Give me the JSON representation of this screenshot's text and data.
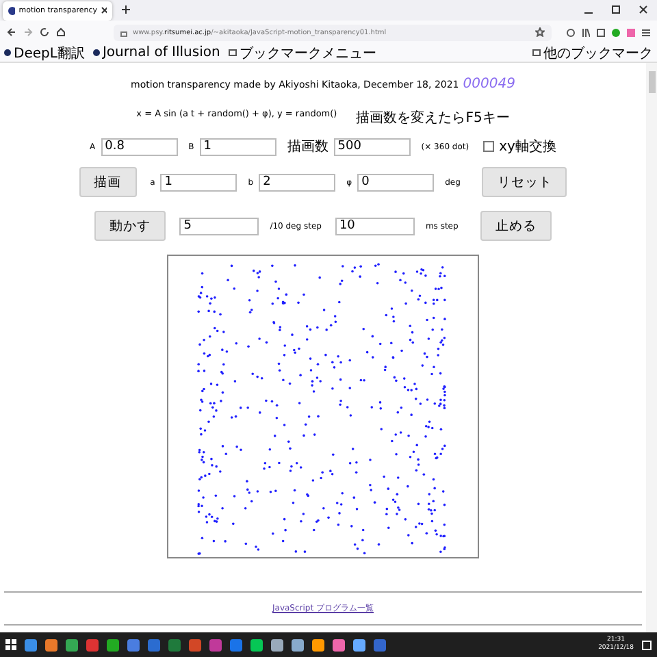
{
  "browser": {
    "tab_title": "motion transparency",
    "url": "www.psy.**ritsumei.ac.jp**/~akitaoka/JavaScript-motion_transparency01.html",
    "bookmarks": [
      {
        "kind": "site",
        "label": "DeepL翻訳"
      },
      {
        "kind": "site",
        "label": "Journal of Illusion"
      },
      {
        "kind": "folder",
        "label": "ブックマークメニュー"
      }
    ],
    "other_bookmarks": "他のブックマーク"
  },
  "page": {
    "credit": "motion transparency made by Akiyoshi Kitaoka, December 18, 2021",
    "counter": "000049",
    "formula": "x = A sin (a t + random() + φ), y = random()",
    "note": "描画数を変えたらF5キー",
    "row1": [
      {
        "kind": "field",
        "label": "A",
        "value": "0.8"
      },
      {
        "kind": "field",
        "label": "B",
        "value": "1"
      },
      {
        "kind": "field",
        "label": "描画数",
        "value": "500"
      },
      {
        "kind": "text",
        "label": "(× 360 dot)"
      },
      {
        "kind": "checkbox",
        "label": "xy軸交換",
        "checked": false
      }
    ],
    "row2": [
      {
        "kind": "button",
        "label": "描画"
      },
      {
        "kind": "field",
        "label": "a",
        "value": "1"
      },
      {
        "kind": "field",
        "label": "b",
        "value": "2"
      },
      {
        "kind": "field",
        "label": "φ",
        "value": "0"
      },
      {
        "kind": "text",
        "label": "deg"
      },
      {
        "kind": "button",
        "label": "リセット"
      }
    ],
    "row3": [
      {
        "kind": "button",
        "label": "動かす"
      },
      {
        "kind": "field",
        "value": "5"
      },
      {
        "kind": "text",
        "label": "/10 deg step"
      },
      {
        "kind": "field",
        "value": "10"
      },
      {
        "kind": "text",
        "label": "ms step"
      },
      {
        "kind": "button",
        "label": "止める"
      }
    ],
    "footer_link": "JavaScript プログラム一覧"
  },
  "taskbar": {
    "time": "21:31",
    "date": "2021/12/18"
  }
}
